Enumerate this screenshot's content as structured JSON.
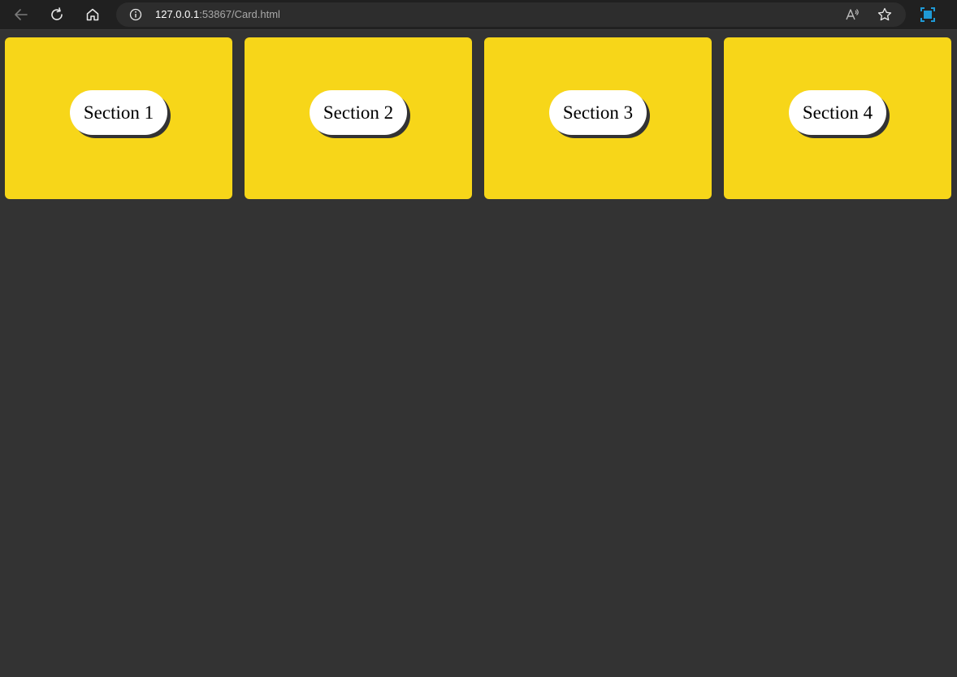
{
  "browser": {
    "url_host": "127.0.0.1",
    "url_rest": ":53867/Card.html",
    "icons": {
      "back": "arrow-left-icon",
      "reload": "reload-icon",
      "home": "home-icon",
      "info": "info-icon",
      "read_aloud": "read-aloud-icon",
      "favorite": "star-icon",
      "extension": "screen-capture-icon"
    },
    "extension_color": "#1f9ad6"
  },
  "page": {
    "background_color": "#333333",
    "card_color": "#f7d619",
    "cards": [
      {
        "label": "Section 1"
      },
      {
        "label": "Section 2"
      },
      {
        "label": "Section 3"
      },
      {
        "label": "Section 4"
      }
    ]
  }
}
